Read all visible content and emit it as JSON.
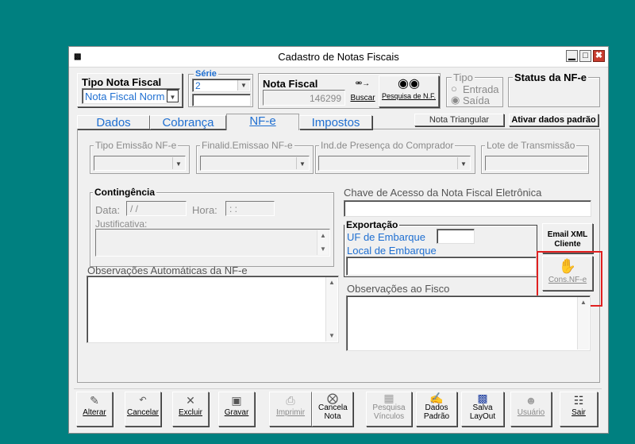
{
  "window": {
    "title": "Cadastro de Notas Fiscais",
    "minimize": "▁",
    "maximize": "□",
    "close": "✖"
  },
  "header": {
    "tipo_nota_label": "Tipo Nota Fiscal",
    "tipo_nota_value": "Nota Fiscal Norm",
    "serie_label": "Série",
    "serie_value": "2",
    "nota_fiscal_label": "Nota Fiscal",
    "nota_fiscal_value": "146299",
    "buscar_label": "Buscar",
    "pesquisa_label": "Pesquisa de N.F.",
    "tipo_label": "Tipo",
    "entrada_label": "Entrada",
    "saida_label": "Saída",
    "status_label": "Status da NF-e"
  },
  "tabs": [
    {
      "label": "Dados"
    },
    {
      "label": "Cobrança"
    },
    {
      "label": "NF-e"
    },
    {
      "label": "Impostos"
    }
  ],
  "buttons": {
    "nota_triangular": "Nota Triangular",
    "ativar_dados": "Ativar dados padrão"
  },
  "nfe": {
    "tipo_emissao_label": "Tipo Emissão NF-e",
    "finalid_label": "Finalid.Emissao NF-e",
    "presenca_label": "Ind.de Presença do Comprador",
    "lote_label": "Lote de Transmissão",
    "contingencia_label": "Contingência",
    "data_label": "Data:",
    "data_value": " / /",
    "hora_label": "Hora:",
    "hora_value": " : :",
    "justificativa_label": "Justificativa:",
    "chave_label": "Chave de Acesso da Nota Fiscal Eletrônica",
    "exportacao_label": "Exportação",
    "uf_embarque_label": "UF de Embarque",
    "local_embarque_label": "Local de Embarque",
    "email_xml_label": "Email XML Cliente",
    "cons_nfe_label": "Cons.NF-e",
    "obs_auto_label": "Observações Automáticas da NF-e",
    "obs_fisco_label": "Observações ao Fisco"
  },
  "toolbar": [
    {
      "label": "Alterar",
      "icon": "edit-icon"
    },
    {
      "label": "Cancelar",
      "icon": "undo-icon"
    },
    {
      "label": "Excluir",
      "icon": "x-icon"
    },
    {
      "label": "Gravar",
      "icon": "save-icon"
    },
    {
      "label": "Imprimir",
      "icon": "printer-icon"
    },
    {
      "label": "Cancela Nota",
      "icon": "cancel-circle-icon"
    },
    {
      "label": "Pesquisa Vínculos",
      "icon": "network-icon"
    },
    {
      "label": "Dados Padrão",
      "icon": "document-edit-icon"
    },
    {
      "label": "Salva LayOut",
      "icon": "save-layout-icon"
    },
    {
      "label": "Usuário",
      "icon": "user-icon"
    },
    {
      "label": "Sair",
      "icon": "exit-door-icon"
    }
  ],
  "colors": {
    "accent_blue": "#1f6fd1",
    "highlight_red": "#e02020"
  }
}
